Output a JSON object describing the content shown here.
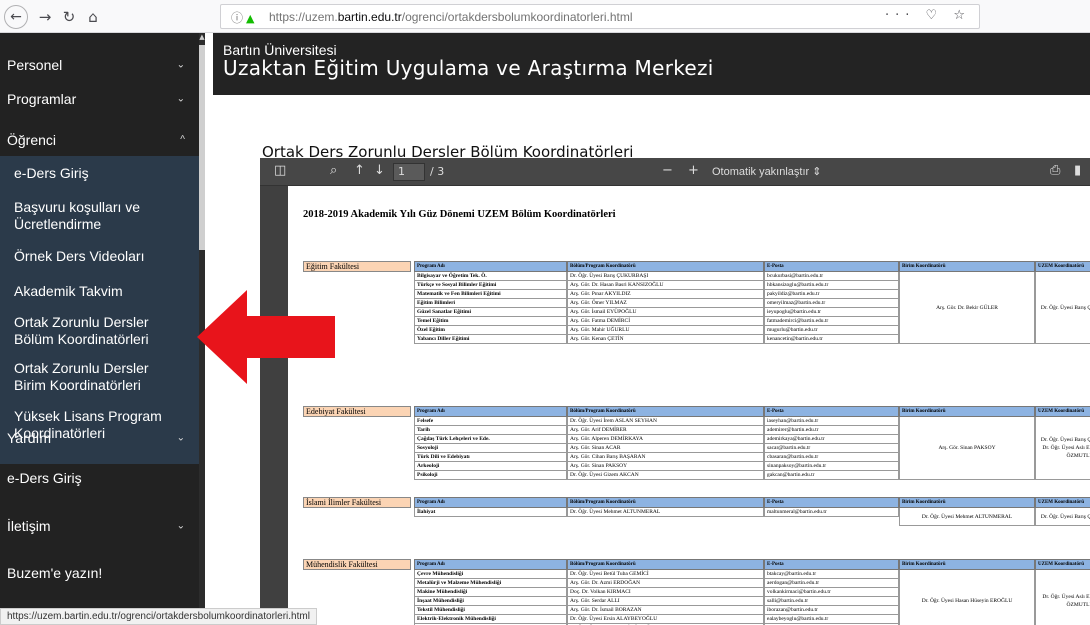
{
  "browser": {
    "url_prefix": "https://uzem.",
    "url_domain": "bartin.edu.tr",
    "url_path": "/ogrenci/ortakdersbolumkoordinatorleri.html",
    "right_icons": "··· ♡ ☆"
  },
  "sidebar": {
    "items": [
      {
        "label": "Personel",
        "chev": "⌄"
      },
      {
        "label": "Programlar",
        "chev": "⌄"
      },
      {
        "label": "Öğrenci",
        "chev": "^"
      },
      {
        "label": "Yardım",
        "chev": "⌄"
      },
      {
        "label": "e-Ders Giriş",
        "chev": ""
      },
      {
        "label": "İletişim",
        "chev": "⌄"
      },
      {
        "label": "Buzem'e yazın!",
        "chev": ""
      }
    ],
    "sub_items": [
      {
        "label": "e-Ders Giriş"
      },
      {
        "label": "Başvuru koşulları ve Ücretlendirme"
      },
      {
        "label": "Örnek Ders Videoları"
      },
      {
        "label": "Akademik Takvim"
      },
      {
        "label": "Ortak Zorunlu Dersler Bölüm Koordinatörleri"
      },
      {
        "label": "Ortak Zorunlu Dersler Birim Koordinatörleri"
      },
      {
        "label": "Yüksek Lisans Program Koordinatörleri"
      }
    ]
  },
  "header": {
    "small": "Bartın Üniversitesi",
    "big": "Uzaktan Eğitim Uygulama ve Araştırma Merkezi"
  },
  "page_title": "Ortak Ders Zorunlu Dersler Bölüm Koordinatörleri",
  "pdf": {
    "page_value": "1",
    "page_count": "/ 3",
    "zoom": "Otomatik yakınlaştır",
    "doc_title": "2018-2019 Akademik Yılı Güz Dönemi UZEM Bölüm Koordinatörleri",
    "headers": [
      "Program Adı",
      "Bölüm/Program Koordinatörü",
      "E-Posta",
      "Birim Koordinatörü",
      "UZEM Koordinatörü"
    ],
    "faculties": [
      {
        "name": "Eğitim Fakültesi",
        "rows": [
          [
            "Bilgisayar ve Öğretim Tek. Ö.",
            "Dr. Öğr. Üyesi Barış ÇUKURBAŞI",
            "bcukurbasi@bartin.edu.tr"
          ],
          [
            "Türkçe ve Sosyal Bilimler Eğitimi",
            "Arş. Gör. Dr. Hasan Basri KANSIZOĞLU",
            "hbkansizoglu@bartin.edu.tr"
          ],
          [
            "Matematik ve Fen Bilimleri Eğitimi",
            "Arş. Gör. Pınar AKYILDIZ",
            "pakyildiz@bartin.edu.tr"
          ],
          [
            "Eğitim Bilimleri",
            "Arş. Gör. Ömer YILMAZ",
            "omeryilmaz@bartin.edu.tr"
          ],
          [
            "Güzel Sanatlar Eğitimi",
            "Arş. Gör. İsmail EYÜPOĞLU",
            "ieyupoglu@bartin.edu.tr"
          ],
          [
            "Temel Eğitim",
            "Arş. Gör. Fatma DEMİRCİ",
            "fatmademirci@bartin.edu.tr"
          ],
          [
            "Özel Eğitim",
            "Arş. Gör. Mahir UĞURLU",
            "mugurlu@bartin.edu.tr"
          ],
          [
            "Yabancı Diller Eğitimi",
            "Arş. Gör. Kenan ÇETİN",
            "kenancetin@bartin.edu.tr"
          ]
        ],
        "birim": [
          "Arş. Gör. Dr. Bekir GÜLER"
        ],
        "uzem": [
          "Dr. Öğr. Üyesi Barış ÇUKURBAŞI"
        ]
      },
      {
        "name": "Edebiyat Fakültesi",
        "rows": [
          [
            "Felsefe",
            "Dr. Öğr. Üyesi İrem ASLAN SEYHAN",
            "iaseyhan@bartin.edu.tr"
          ],
          [
            "Tarih",
            "Arş. Gör. Arif DEMİRER",
            "ademirer@bartin.edu.tr"
          ],
          [
            "Çağdaş Türk Lehçeleri ve Ede.",
            "Arş. Gör. Alperen DEMİRKAYA",
            "ademirkaya@bartin.edu.tr"
          ],
          [
            "Sosyoloji",
            "Arş. Gör. Sinan ACAR",
            "sacar@bartin.edu.tr"
          ],
          [
            "Türk Dili ve Edebiyatı",
            "Arş. Gör. Cihan Barış BAŞARAN",
            "cbasaran@bartin.edu.tr"
          ],
          [
            "Arkeoloji",
            "Arş. Gör. Sinan PAKSOY",
            "sinanpaksoy@bartin.edu.tr"
          ],
          [
            "Psikoloji",
            "Dr. Öğr. Üyesi Gizem AKCAN",
            "gakcan@bartin.edu.tr"
          ]
        ],
        "birim": [
          "Arş. Gör. Sinan PAKSOY"
        ],
        "uzem": [
          "Dr. Öğr. Üyesi Barış ÇUKURBAŞI",
          "Dr. Öğr. Üyesi Aslı EYECİOĞLU",
          "ÖZMUTLU"
        ]
      },
      {
        "name": "İslami İlimler Fakültesi",
        "rows": [
          [
            "İlahiyat",
            "Dr. Öğr. Üyesi Mehmet ALTUNMERAL",
            "maltunmeral@bartin.edu.tr"
          ]
        ],
        "birim": [
          "Dr. Öğr. Üyesi Mehmet ALTUNMERAL"
        ],
        "uzem": [
          "Dr. Öğr. Üyesi Barış ÇUKURBAŞI"
        ]
      },
      {
        "name": "Mühendislik Fakültesi",
        "rows": [
          [
            "Çevre Mühendisliği",
            "Dr. Öğr. Üyesi Betül Tuba GEMİCİ",
            "btakcay@bartin.edu.tr"
          ],
          [
            "Metalürji ve Malzeme Mühendisliği",
            "Arş. Gör. Dr. Azmi ERDOĞAN",
            "aerdogan@bartin.edu.tr"
          ],
          [
            "Makine Mühendisliği",
            "Doç. Dr. Volkan KIRMACI",
            "volkankirmaci@bartin.edu.tr"
          ],
          [
            "İnşaat Mühendisliği",
            "Arş. Gör. Serdar ALLI",
            "salli@bartin.edu.tr"
          ],
          [
            "Tekstil Mühendisliği",
            "Arş. Gör. Dr. İsmail BORAZAN",
            "iborazan@bartin.edu.tr"
          ],
          [
            "Elektrik-Elektronik Mühendisliği",
            "Dr. Öğr. Üyesi Ersin ALAYBEYOĞLU",
            "ealaybeyoglu@bartin.edu.tr"
          ],
          [
            "Bilgisayar Mühendisliği",
            "Dr. Öğr. Üyesi Aslı EYECİOĞLU ÖZMUTLU",
            "aozmutlu@bartin.edu.tr"
          ]
        ],
        "birim": [
          "Dr. Öğr. Üyesi Hasan Hüseyin EROĞLU"
        ],
        "uzem": [
          "Dr. Öğr. Üyesi Aslı EYECİOĞLU",
          "ÖZMUTLU"
        ]
      }
    ]
  },
  "status_url": "https://uzem.bartin.edu.tr/ogrenci/ortakdersbolumkoordinatorleri.html",
  "colors": {
    "sidebar_bg": "#222222",
    "submenu_bg": "#2b3a4a",
    "header_blue": "#8db3e2",
    "faculty_orange": "#fbd4b4",
    "arrow_red": "#e8141b"
  }
}
